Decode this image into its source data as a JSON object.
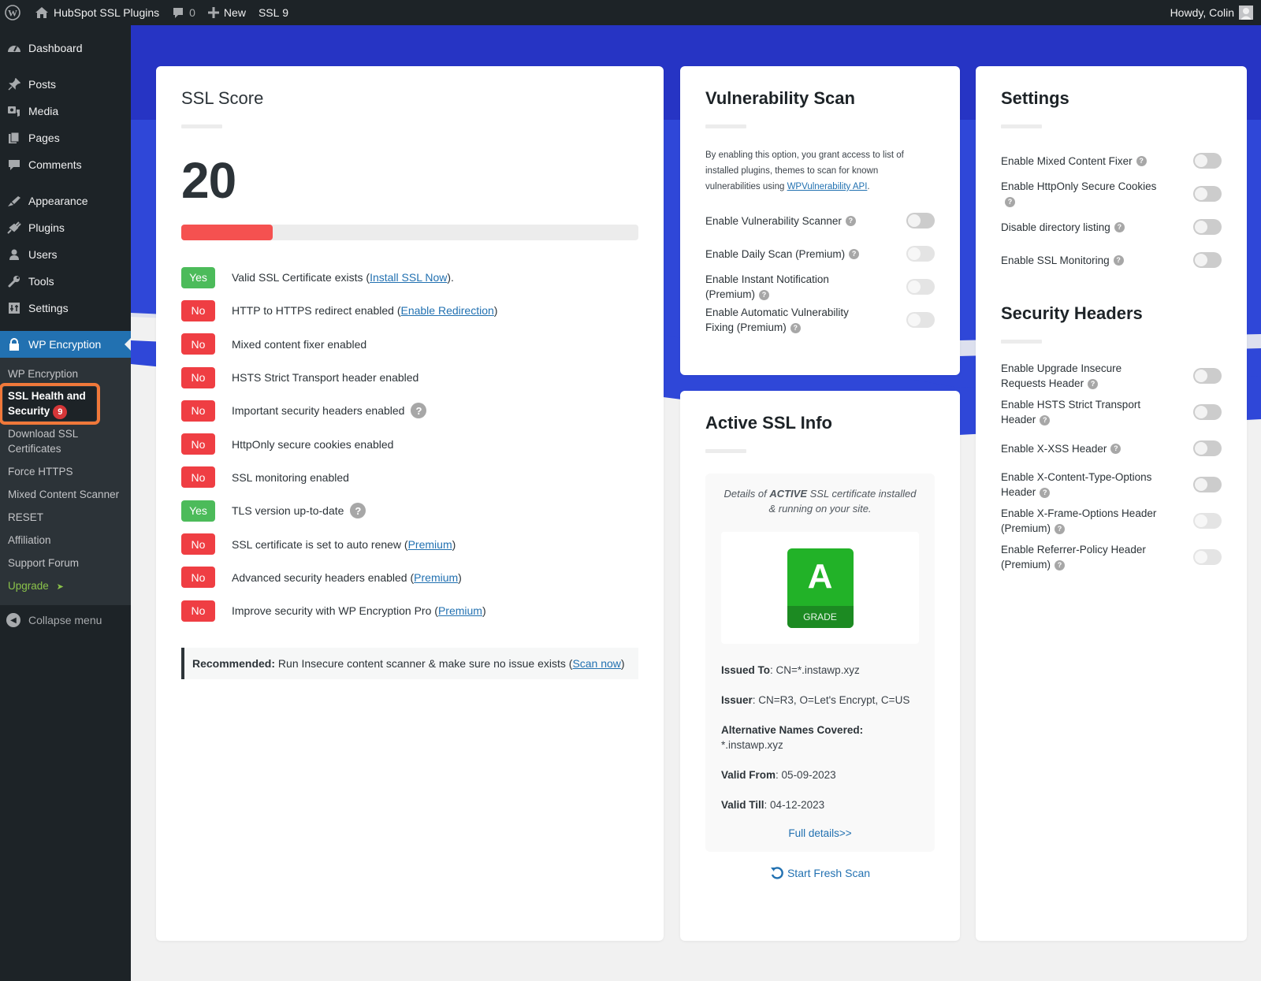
{
  "adminbar": {
    "site_name": "HubSpot SSL Plugins",
    "comments_count": "0",
    "new_label": "New",
    "ssl_label": "SSL",
    "ssl_count": "9",
    "greeting": "Howdy, Colin"
  },
  "sidebar": {
    "items": [
      {
        "label": "Dashboard",
        "icon": "dashboard-icon"
      },
      {
        "label": "Posts",
        "icon": "pin-icon"
      },
      {
        "label": "Media",
        "icon": "media-icon"
      },
      {
        "label": "Pages",
        "icon": "pages-icon"
      },
      {
        "label": "Comments",
        "icon": "comment-icon"
      },
      {
        "label": "Appearance",
        "icon": "brush-icon"
      },
      {
        "label": "Plugins",
        "icon": "plug-icon"
      },
      {
        "label": "Users",
        "icon": "user-icon"
      },
      {
        "label": "Tools",
        "icon": "wrench-icon"
      },
      {
        "label": "Settings",
        "icon": "settings-icon"
      },
      {
        "label": "WP Encryption",
        "icon": "lock-icon"
      }
    ],
    "submenu": [
      {
        "label": "WP Encryption"
      },
      {
        "label": "SSL Health and Security",
        "badge": "9"
      },
      {
        "label": "Download SSL Certificates"
      },
      {
        "label": "Force HTTPS"
      },
      {
        "label": "Mixed Content Scanner"
      },
      {
        "label": "RESET"
      },
      {
        "label": "Affiliation"
      },
      {
        "label": "Support Forum"
      },
      {
        "label": "Upgrade",
        "arrow": "➤"
      }
    ],
    "collapse_label": "Collapse menu"
  },
  "ssl_score": {
    "title": "SSL Score",
    "score": "20",
    "score_percent": 20,
    "checks": [
      {
        "status": "Yes",
        "text": "Valid SSL Certificate exists (",
        "link": "Install SSL Now",
        "after": ")."
      },
      {
        "status": "No",
        "text": "HTTP to HTTPS redirect enabled (",
        "link": "Enable Redirection",
        "after": ")"
      },
      {
        "status": "No",
        "text": "Mixed content fixer enabled"
      },
      {
        "status": "No",
        "text": "HSTS Strict Transport header enabled"
      },
      {
        "status": "No",
        "text": "Important security headers enabled",
        "help": true
      },
      {
        "status": "No",
        "text": "HttpOnly secure cookies enabled"
      },
      {
        "status": "No",
        "text": "SSL monitoring enabled"
      },
      {
        "status": "Yes",
        "text": "TLS version up-to-date",
        "help": true
      },
      {
        "status": "No",
        "text": "SSL certificate is set to auto renew (",
        "link": "Premium",
        "after": ")"
      },
      {
        "status": "No",
        "text": "Advanced security headers enabled (",
        "link": "Premium",
        "after": ")"
      },
      {
        "status": "No",
        "text": "Improve security with WP Encryption Pro (",
        "link": "Premium",
        "after": ")"
      }
    ],
    "recommend_label": "Recommended:",
    "recommend_text": " Run Insecure content scanner & make sure no issue exists (",
    "recommend_link": "Scan now",
    "recommend_after": ")"
  },
  "vulnerability": {
    "title": "Vulnerability Scan",
    "description": "By enabling this option, you grant access to list of installed plugins, themes to scan for known vulnerabilities using ",
    "description_link": "WPVulnerability API",
    "description_after": ".",
    "toggles": [
      {
        "label": "Enable Vulnerability Scanner",
        "on": false,
        "disabled": false
      },
      {
        "label": "Enable Daily Scan (Premium)",
        "on": false,
        "disabled": true
      },
      {
        "label": "Enable Instant Notification (Premium)",
        "on": false,
        "disabled": true
      },
      {
        "label": "Enable Automatic Vulnerability Fixing (Premium)",
        "on": false,
        "disabled": true
      }
    ]
  },
  "active_ssl": {
    "title": "Active SSL Info",
    "intro_pre": "Details of ",
    "intro_bold": "ACTIVE",
    "intro_post": " SSL certificate installed & running on your site.",
    "grade": "A",
    "grade_label": "GRADE",
    "issued_to_label": "Issued To",
    "issued_to": "CN=*.instawp.xyz",
    "issuer_label": "Issuer",
    "issuer": "CN=R3, O=Let's Encrypt, C=US",
    "alt_names_label": "Alternative Names Covered:",
    "alt_names": "*.instawp.xyz",
    "valid_from_label": "Valid From",
    "valid_from": "05-09-2023",
    "valid_till_label": "Valid Till",
    "valid_till": "04-12-2023",
    "full_details": "Full details>>",
    "fresh_scan": "Start Fresh Scan"
  },
  "settings": {
    "title": "Settings",
    "toggles": [
      {
        "label": "Enable Mixed Content Fixer",
        "on": false,
        "disabled": false
      },
      {
        "label": "Enable HttpOnly Secure Cookies",
        "on": false,
        "disabled": false
      },
      {
        "label": "Disable directory listing",
        "on": false,
        "disabled": false
      },
      {
        "label": "Enable SSL Monitoring",
        "on": false,
        "disabled": false
      }
    ]
  },
  "security_headers": {
    "title": "Security Headers",
    "toggles": [
      {
        "label": "Enable Upgrade Insecure Requests Header",
        "on": false,
        "disabled": false
      },
      {
        "label": "Enable HSTS Strict Transport Header",
        "on": false,
        "disabled": false
      },
      {
        "label": "Enable X-XSS Header",
        "on": false,
        "disabled": false
      },
      {
        "label": "Enable X-Content-Type-Options Header",
        "on": false,
        "disabled": false
      },
      {
        "label": "Enable X-Frame-Options Header (Premium)",
        "on": false,
        "disabled": true
      },
      {
        "label": "Enable Referrer-Policy Header (Premium)",
        "on": false,
        "disabled": true
      }
    ]
  },
  "colors": {
    "yes": "#4cbb5a",
    "no": "#ef3e43",
    "score_fill": "#f55150",
    "accent": "#2271b1",
    "grade": "#22b228",
    "highlight": "#f0783a",
    "banner_blue": "#2b3fcf"
  }
}
